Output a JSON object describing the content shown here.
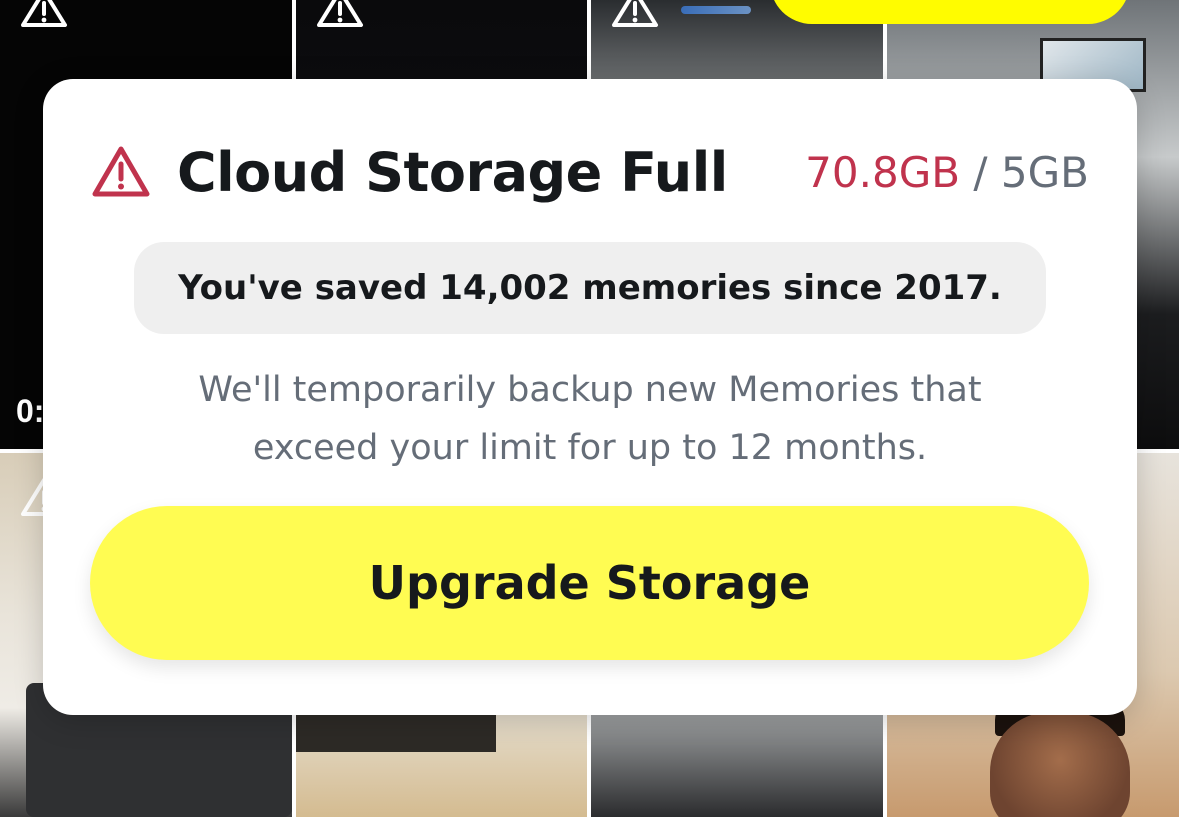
{
  "background_tiles": {
    "duration_partial": "0:"
  },
  "dialog": {
    "title": "Cloud Storage Full",
    "icon": "warning-triangle-icon",
    "storage_used": "70.8GB",
    "storage_separator": " / ",
    "storage_limit": "5GB",
    "saved_message": "You've saved 14,002 memories since 2017.",
    "info_line1": "We'll temporarily backup new Memories that",
    "info_line2": "exceed your limit for up to 12 months.",
    "upgrade_label": "Upgrade Storage"
  },
  "colors": {
    "accent_yellow": "#fffc52",
    "used_red": "#c0334d",
    "muted_gray": "#656d78",
    "title_dark": "#16191c",
    "pill_bg": "#efefef"
  }
}
